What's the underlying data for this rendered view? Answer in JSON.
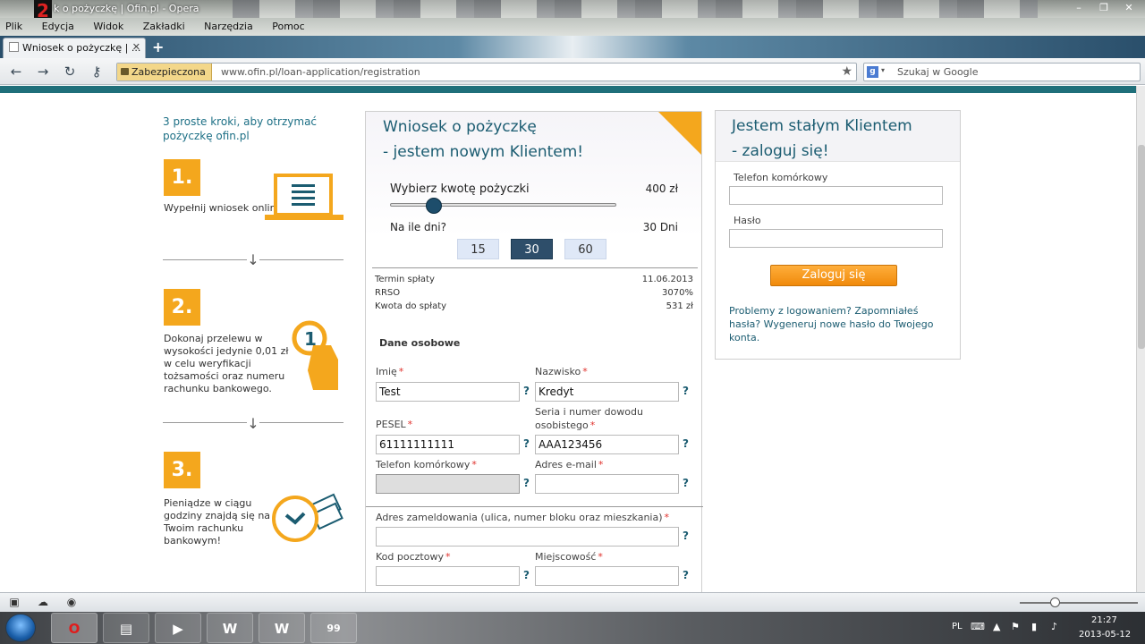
{
  "window": {
    "title": "k o pożyczkę | Ofin.pl - Opera",
    "controls": [
      "–",
      "❐",
      "✕"
    ]
  },
  "menu": [
    "Plik",
    "Edycja",
    "Widok",
    "Zakładki",
    "Narzędzia",
    "Pomoc"
  ],
  "tab": {
    "title": "Wniosek o pożyczkę | ...",
    "close": "✕",
    "new": "+"
  },
  "address": {
    "secure_label": "Zabezpieczona",
    "url": "www.ofin.pl/loan-application/registration"
  },
  "search": {
    "placeholder": "Szukaj w Google",
    "engine_icon": "g-icon"
  },
  "steps": {
    "heading": "3 proste kroki, aby otrzymać pożyczkę ofin.pl",
    "items": [
      {
        "num": "1.",
        "text": "Wypełnij wniosek online",
        "icon": "laptop-icon"
      },
      {
        "num": "2.",
        "text": "Dokonaj przelewu w wysokości jedynie 0,01 zł w celu weryfikacji tożsamości oraz numeru rachunku bankowego.",
        "icon": "hand-coin-icon"
      },
      {
        "num": "3.",
        "text": "Pieniądze w ciągu godziny znajdą się na Twoim rachunku bankowym!",
        "icon": "clock-money-icon"
      }
    ]
  },
  "loan": {
    "title_1": "Wniosek o pożyczkę",
    "title_2": "- jestem nowym Klientem!",
    "amount_label": "Wybierz kwotę pożyczki",
    "amount_value": "400 zł",
    "slider_fraction": 0.2,
    "days_label": "Na ile dni?",
    "days_value": "30 Dni",
    "day_options": [
      "15",
      "30",
      "60"
    ],
    "selected_day": "30",
    "summary": [
      {
        "label": "Termin spłaty",
        "value": "11.06.2013"
      },
      {
        "label": "RRSO",
        "value": "3070%"
      },
      {
        "label": "Kwota do spłaty",
        "value": "531 zł"
      }
    ],
    "section_personal": "Dane osobowe",
    "fields": {
      "imie": {
        "label": "Imię",
        "value": "Test"
      },
      "nazwisko": {
        "label": "Nazwisko",
        "value": "Kredyt"
      },
      "pesel": {
        "label": "PESEL",
        "value": "61111111111"
      },
      "dowod": {
        "label": "Seria i numer dowodu osobistego",
        "value": "AAA123456"
      },
      "telefon": {
        "label": "Telefon komórkowy",
        "value": ""
      },
      "email": {
        "label": "Adres e-mail",
        "value": ""
      },
      "adres": {
        "label": "Adres zameldowania (ulica, numer bloku oraz mieszkania)",
        "value": ""
      },
      "kod": {
        "label": "Kod pocztowy",
        "value": ""
      },
      "miejscowosc": {
        "label": "Miejscowość",
        "value": ""
      }
    },
    "required_mark": "*",
    "help_mark": "?"
  },
  "login": {
    "title_1": "Jestem stałym Klientem",
    "title_2": "- zaloguj się!",
    "phone_label": "Telefon komórkowy",
    "password_label": "Hasło",
    "button": "Zaloguj się",
    "footer": "Problemy z logowaniem? Zapomniałeś hasła? Wygeneruj nowe hasło do Twojego konta."
  },
  "taskbar": {
    "lang": "PL",
    "time": "21:27",
    "date": "2013-05-12",
    "apps": [
      "opera",
      "explorer",
      "media",
      "WoT",
      "WoT",
      "99"
    ]
  },
  "colors": {
    "accent_orange": "#f4a71d",
    "title_teal": "#1b5c71",
    "required_red": "#e0312c"
  }
}
